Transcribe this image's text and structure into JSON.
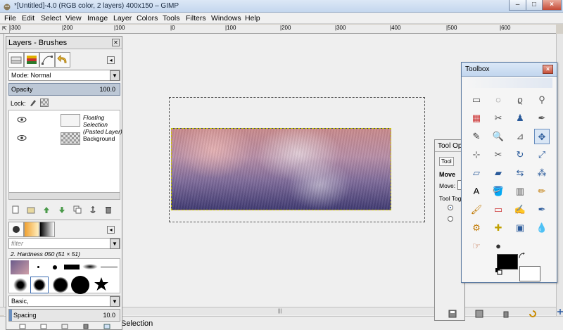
{
  "window": {
    "title": "*[Untitled]-4.0 (RGB color, 2 layers) 400x150 – GIMP",
    "minimize_label": "–",
    "maximize_label": "□",
    "close_label": "×"
  },
  "menu": [
    "File",
    "Edit",
    "Select",
    "View",
    "Image",
    "Layer",
    "Colors",
    "Tools",
    "Filters",
    "Windows",
    "Help"
  ],
  "ruler": {
    "corner": "⇱",
    "ticks": [
      "|300",
      "|200",
      "|100",
      "|0",
      "|100",
      "|200",
      "|300",
      "|400",
      "|500",
      "|600"
    ]
  },
  "layers_panel": {
    "title": "Layers - Brushes",
    "mode_label": "Mode: Normal",
    "opacity_label": "Opacity",
    "opacity_value": "100.0",
    "lock_label": "Lock:",
    "layers": [
      {
        "name_line1": "Floating Selection",
        "name_line2": "(Pasted Layer)"
      },
      {
        "name_line1": "Background",
        "name_line2": ""
      }
    ]
  },
  "brushes_panel": {
    "filter_placeholder": "filter",
    "brush_name": "2. Hardness 050 (51 × 51)",
    "preset_label": "Basic,",
    "spacing_label": "Spacing",
    "spacing_value": "10.0"
  },
  "toolbox": {
    "title": "Toolbox",
    "close_label": "×",
    "tools": [
      "rect-select",
      "ellipse-select",
      "free-select",
      "fuzzy-select",
      "color-select",
      "scissors-select",
      "foreground-select",
      "paths",
      "color-picker",
      "zoom",
      "measure",
      "move",
      "align",
      "crop",
      "rotate",
      "scale",
      "shear",
      "perspective",
      "flip",
      "cage-transform",
      "text",
      "bucket-fill",
      "blend",
      "pencil",
      "paintbrush",
      "eraser",
      "airbrush",
      "ink",
      "clone",
      "heal",
      "perspective-clone",
      "blur",
      "smudge",
      "dodge-burn"
    ],
    "tool_glyphs": [
      "▭",
      "◌",
      "ϱ",
      "⚲",
      "▦",
      "✂",
      "♟",
      "✒",
      "✎",
      "🔍",
      "⊿",
      "✥",
      "⊹",
      "✂",
      "↻",
      "⤢",
      "▱",
      "▰",
      "⇆",
      "⁂",
      "A",
      "🪣",
      "▥",
      "✏",
      "🖌",
      "▭",
      "✍",
      "✒",
      "⚙",
      "✚",
      "▣",
      "💧",
      "☞",
      "●"
    ]
  },
  "tool_options": {
    "title": "Tool Op",
    "tool_name": "Tool",
    "section": "Move",
    "move_label": "Move:",
    "toggle_label": "Tool Tog"
  },
  "statusbar": {
    "text": "Selection"
  },
  "colors": {
    "fg": "#000000",
    "bg": "#ffffff"
  }
}
